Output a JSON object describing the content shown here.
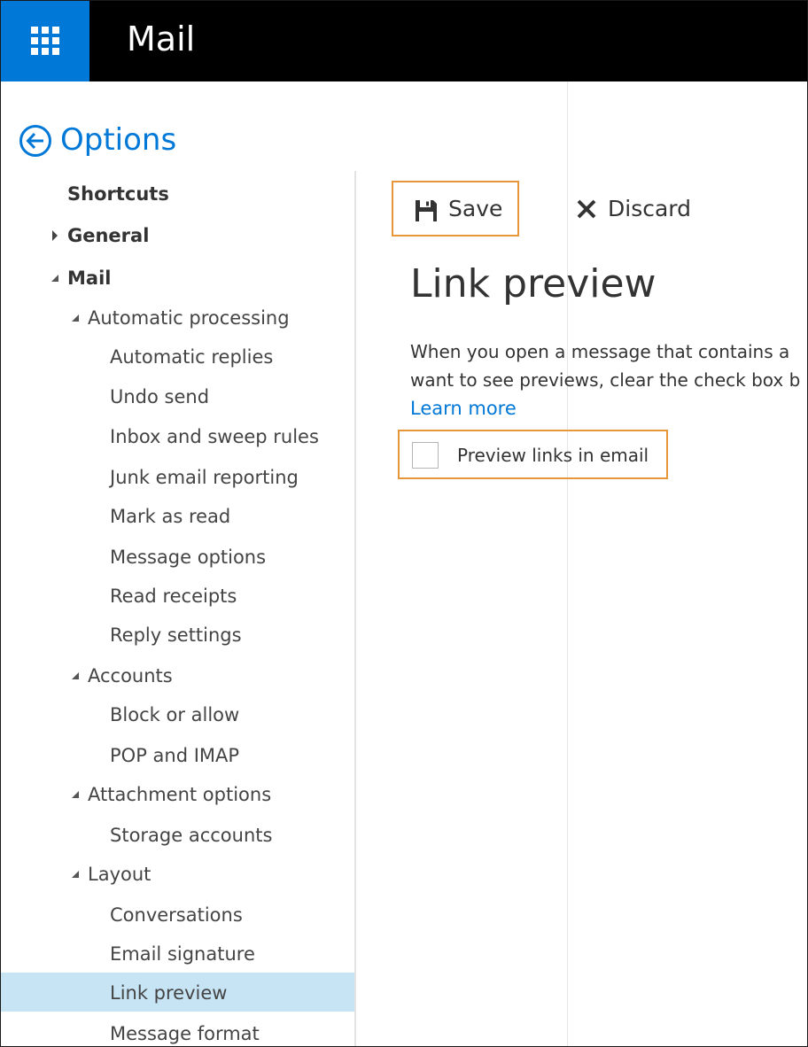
{
  "app": {
    "title": "Mail"
  },
  "options": {
    "title": "Options"
  },
  "nav": {
    "items": [
      {
        "label": "Shortcuts"
      },
      {
        "label": "General"
      },
      {
        "label": "Mail"
      },
      {
        "label": "Automatic processing"
      },
      {
        "label": "Automatic replies"
      },
      {
        "label": "Undo send"
      },
      {
        "label": "Inbox and sweep rules"
      },
      {
        "label": "Junk email reporting"
      },
      {
        "label": "Mark as read"
      },
      {
        "label": "Message options"
      },
      {
        "label": "Read receipts"
      },
      {
        "label": "Reply settings"
      },
      {
        "label": "Accounts"
      },
      {
        "label": "Block or allow"
      },
      {
        "label": "POP and IMAP"
      },
      {
        "label": "Attachment options"
      },
      {
        "label": "Storage accounts"
      },
      {
        "label": "Layout"
      },
      {
        "label": "Conversations"
      },
      {
        "label": "Email signature"
      },
      {
        "label": "Link preview"
      },
      {
        "label": "Message format"
      }
    ],
    "selected": "Link preview"
  },
  "toolbar": {
    "save_label": "Save",
    "discard_label": "Discard"
  },
  "content": {
    "title": "Link preview",
    "description_line1": "When you open a message that contains a",
    "description_line2": "want to see previews, clear the check box b",
    "learn_more": "Learn more",
    "checkbox_label": "Preview links in email",
    "checkbox_checked": false
  },
  "colors": {
    "accent": "#0078d7",
    "highlight": "#e8963a",
    "selected_bg": "#c7e4f5",
    "topbar": "#000000"
  },
  "icons": {
    "waffle": "app-launcher-icon",
    "back": "back-arrow-circle-icon",
    "save": "floppy-disk-icon",
    "discard": "close-x-icon"
  }
}
